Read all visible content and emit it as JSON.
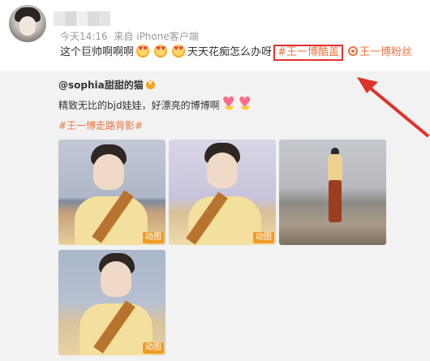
{
  "post": {
    "meta": {
      "time": "今天14:16",
      "source": "来自 iPhone客户端"
    },
    "text": "这个巨帅啊啊啊",
    "text_after": "天天花痴怎么办呀",
    "hashtag_boxed": "#王一博酷盖",
    "super_topic": "王一博粉丝"
  },
  "repost": {
    "author": "@sophia甜甜的猫",
    "text": "精致无比的bjd娃娃，好漂亮的博博啊",
    "tag": "#王一博走路背影#",
    "badge": "动图"
  },
  "colors": {
    "hashtag": "#eb7340",
    "highlight_box": "#e0322b",
    "badge": "#f39a22",
    "repost_bg": "#f2f2f2"
  }
}
